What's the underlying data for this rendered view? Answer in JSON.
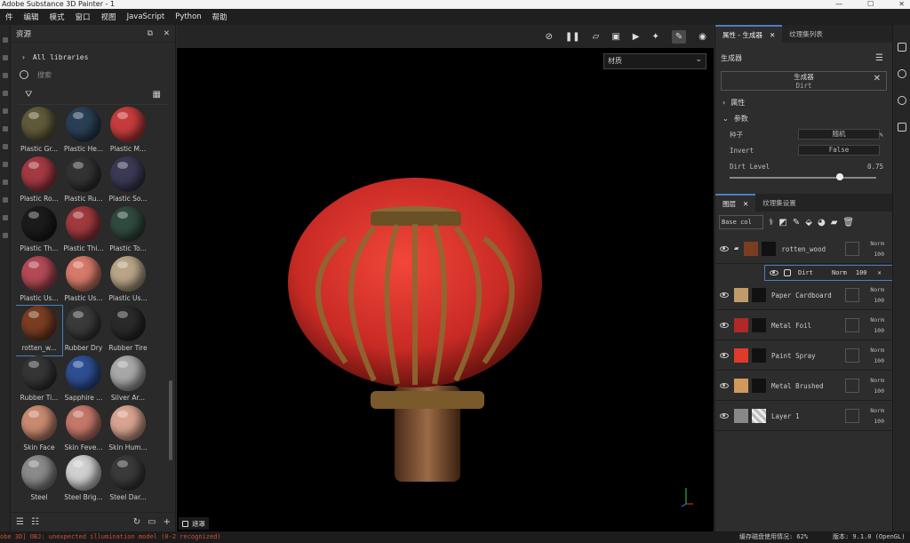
{
  "titlebar": {
    "title": "Adobe Substance 3D Painter - 1"
  },
  "menu": [
    "件",
    "编辑",
    "模式",
    "窗口",
    "视图",
    "JavaScript",
    "Python",
    "帮助"
  ],
  "library": {
    "title": "资源",
    "all_libraries": "All libraries",
    "search_placeholder": "搜索",
    "items": [
      {
        "label": "Plastic Gr...",
        "color": "#5f5a3a"
      },
      {
        "label": "Plastic He...",
        "color": "#2a3f55"
      },
      {
        "label": "Plastic M...",
        "color": "#c63c3c"
      },
      {
        "label": "Plastic Ro...",
        "color": "#a33a42"
      },
      {
        "label": "Plastic Ru...",
        "color": "#333"
      },
      {
        "label": "Plastic So...",
        "color": "#3b3a55"
      },
      {
        "label": "Plastic Th...",
        "color": "#1b1b1b"
      },
      {
        "label": "Plastic Thi...",
        "color": "#a03a3e"
      },
      {
        "label": "Plastic To...",
        "color": "#2f4a3f"
      },
      {
        "label": "Plastic Us...",
        "color": "#b34a55"
      },
      {
        "label": "Plastic Us...",
        "color": "#d67a6a"
      },
      {
        "label": "Plastic Us...",
        "color": "#b8a588"
      },
      {
        "label": "rotten_w...",
        "color": "#7a3d22"
      },
      {
        "label": "Rubber Dry",
        "color": "#3a3a3a"
      },
      {
        "label": "Rubber Tire",
        "color": "#2a2a2a"
      },
      {
        "label": "Rubber Ti...",
        "color": "#353535"
      },
      {
        "label": "Sapphire ...",
        "color": "#2d4f92"
      },
      {
        "label": "Silver Ar...",
        "color": "#a8a8a8"
      },
      {
        "label": "Skin Face",
        "color": "#c98a70"
      },
      {
        "label": "Skin Feve...",
        "color": "#c4786a"
      },
      {
        "label": "Skin Hum...",
        "color": "#d8a390"
      },
      {
        "label": "Steel",
        "color": "#8a8a8a"
      },
      {
        "label": "Steel Brig...",
        "color": "#d0d0d0"
      },
      {
        "label": "Steel Dar...",
        "color": "#3a3a3a"
      }
    ]
  },
  "viewport": {
    "material_select": "材质",
    "mask_label": "遮罩"
  },
  "properties": {
    "tab1": "属性 - 生成器",
    "tab2": "纹理集列表",
    "header": "生成器",
    "gen_name": "生成器",
    "gen_sub": "Dirt",
    "section_attr": "属性",
    "section_params": "参数",
    "seed_label": "种子",
    "seed_value": "随机",
    "invert_label": "Invert",
    "invert_value": "False",
    "dirt_level_label": "Dirt Level",
    "dirt_level_value": "0.75",
    "dirt_level_fraction": 0.75
  },
  "layers": {
    "tab1": "图层",
    "tab2": "纹理集设置",
    "blend_select": "Base col",
    "items": [
      {
        "name": "rotten_wood",
        "blend": "Norm",
        "opacity": "100",
        "color": "#7a3d22"
      },
      {
        "name": "Paper Cardboard",
        "blend": "Norm",
        "opacity": "100",
        "color": "#c29a6a"
      },
      {
        "name": "Metal Foil",
        "blend": "Norm",
        "opacity": "100",
        "color": "#b02828"
      },
      {
        "name": "Paint Spray",
        "blend": "Norm",
        "opacity": "100",
        "color": "#e03a2a"
      },
      {
        "name": "Metal Brushed",
        "blend": "Norm",
        "opacity": "100",
        "color": "#d29a5a"
      },
      {
        "name": "Layer 1",
        "blend": "Norm",
        "opacity": "100",
        "color": "#888"
      }
    ],
    "sub": {
      "name": "Dirt",
      "blend": "Norm",
      "opacity": "100"
    }
  },
  "status": {
    "error": "obe 3D] OBJ: unexpected illumination model (0-2 recognized)",
    "memory": "缓存磁盘使用情况:  62%",
    "version": "版本: 9.1.0 (OpenGL)"
  }
}
